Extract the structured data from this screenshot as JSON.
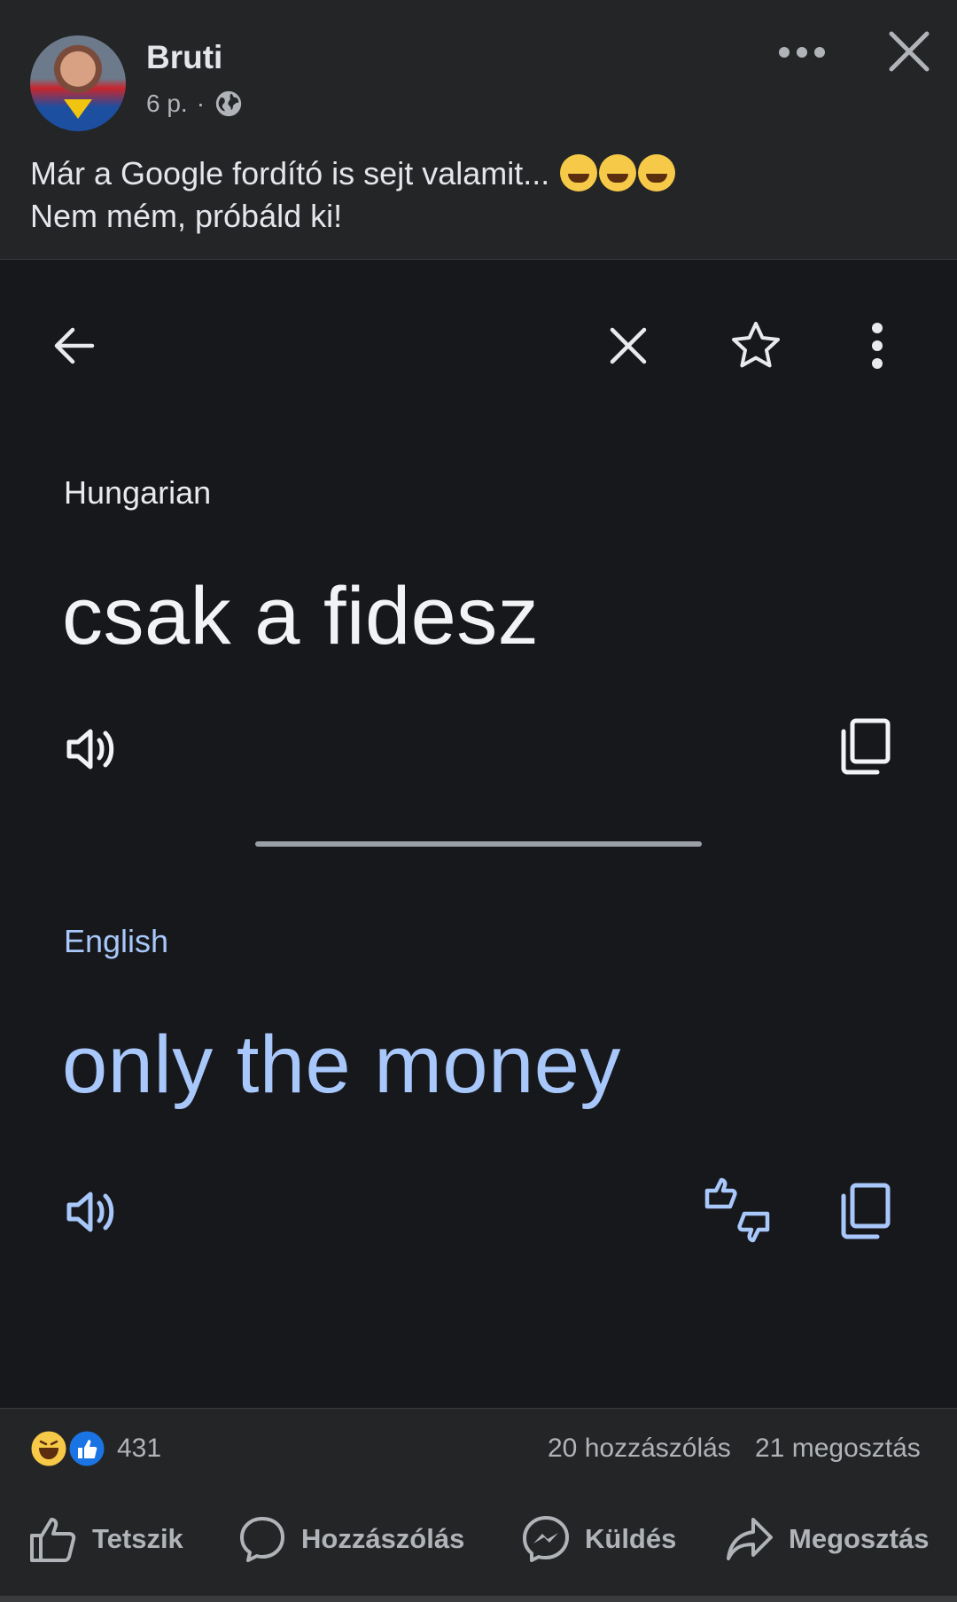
{
  "post": {
    "author": "Bruti",
    "time": "6 p.",
    "separator": "·",
    "caption_line1": "Már a Google fordító is sejt valamit...",
    "caption_line2": "Nem mém, próbáld ki!",
    "avatar_icon": "avatar-superman",
    "more_icon": "more-horizontal-icon",
    "close_icon": "close-icon"
  },
  "translate": {
    "source_language": "Hungarian",
    "source_text": "csak a fidesz",
    "target_language": "English",
    "target_text": "only the money",
    "colors": {
      "background": "#17181c",
      "source_text": "#f1f3f4",
      "target_text": "#a8c7fa"
    }
  },
  "reactions": {
    "count": "431",
    "comments": "20 hozzászólás",
    "shares": "21 megosztás",
    "types": [
      "haha",
      "like"
    ]
  },
  "actions": {
    "like": "Tetszik",
    "comment": "Hozzászólás",
    "send": "Küldés",
    "share": "Megosztás"
  }
}
